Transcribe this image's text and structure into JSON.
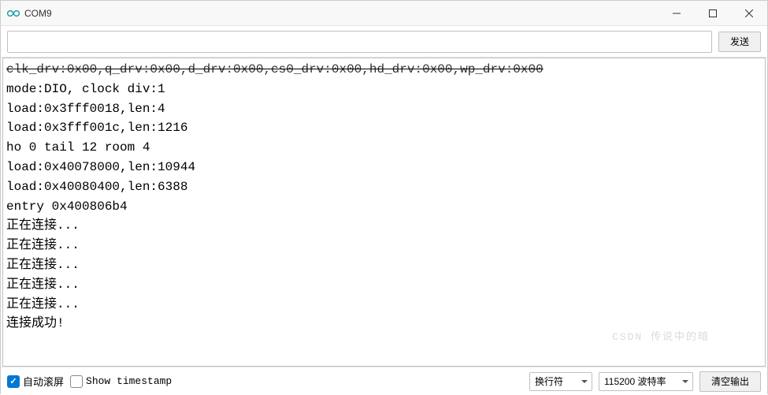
{
  "window": {
    "title": "COM9"
  },
  "toolbar": {
    "input_value": "",
    "send_label": "发送"
  },
  "console": {
    "lines": [
      "clk_drv:0x00,q_drv:0x00,d_drv:0x00,cs0_drv:0x00,hd_drv:0x00,wp_drv:0x00",
      "mode:DIO, clock div:1",
      "load:0x3fff0018,len:4",
      "load:0x3fff001c,len:1216",
      "ho 0 tail 12 room 4",
      "load:0x40078000,len:10944",
      "load:0x40080400,len:6388",
      "entry 0x400806b4",
      "正在连接...",
      "正在连接...",
      "正在连接...",
      "正在连接...",
      "正在连接...",
      "连接成功!"
    ]
  },
  "statusbar": {
    "autoscroll_label": "自动滚屏",
    "autoscroll_checked": true,
    "timestamp_label": "Show timestamp",
    "timestamp_checked": false,
    "line_ending": "换行符",
    "baud_rate": "115200 波特率",
    "clear_label": "清空输出"
  },
  "watermark": "CSDN 传说中的暗"
}
